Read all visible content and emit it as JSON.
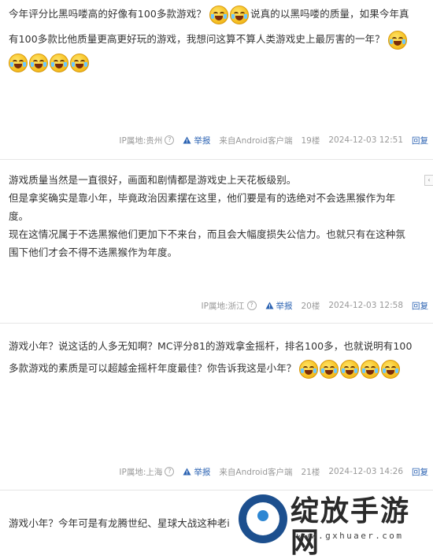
{
  "posts": [
    {
      "text_lines": [
        "今年评分比黑吗喽高的好像有100多款游戏？",
        "说真的以黑吗喽的质量，如果今年真",
        "有100多款比他质量更高更好玩的游戏，我想问这算不算人类游戏史上最厉害的一年？"
      ],
      "ip": "IP属地:贵州",
      "report": "举报",
      "source": "来自Android客户端",
      "floor": "19楼",
      "time": "2024-12-03 12:51",
      "reply": "回复"
    },
    {
      "text_lines": [
        "游戏质量当然是一直很好，画面和剧情都是游戏史上天花板级别。",
        "但是拿奖确实是靠小年，毕竟政治因素摆在这里，他们要是有的选绝对不会选黑猴作为年",
        "度。",
        "现在这情况属于不选黑猴他们更加下不来台，而且会大幅度损失公信力。也就只有在这种氛",
        "围下他们才会不得不选黑猴作为年度。"
      ],
      "ip": "IP属地:浙江",
      "report": "举报",
      "source": "",
      "floor": "20楼",
      "time": "2024-12-03 12:58",
      "reply": "回复"
    },
    {
      "text_lines": [
        "游戏小年？说这话的人多无知啊？MC评分81的游戏拿金摇杆，排名100多，也就说明有100",
        "多款游戏的素质是可以超越金摇杆年度最佳？你告诉我这是小年？"
      ],
      "ip": "IP属地:上海",
      "report": "举报",
      "source": "来自Android客户端",
      "floor": "21楼",
      "time": "2024-12-03 14:26",
      "reply": "回复"
    },
    {
      "text_lines": [
        "游戏小年？今年可是有龙腾世纪、星球大战这种老i"
      ]
    }
  ],
  "watermark": {
    "title": "绽放手游网",
    "url": "www.gxhuaer.com"
  },
  "icons": {
    "emoji": "laughing-tears-emoji",
    "report": "warning-triangle-icon",
    "help": "question-circle-icon"
  },
  "colors": {
    "link": "#2d64b3",
    "meta": "#999999",
    "text": "#333333"
  }
}
